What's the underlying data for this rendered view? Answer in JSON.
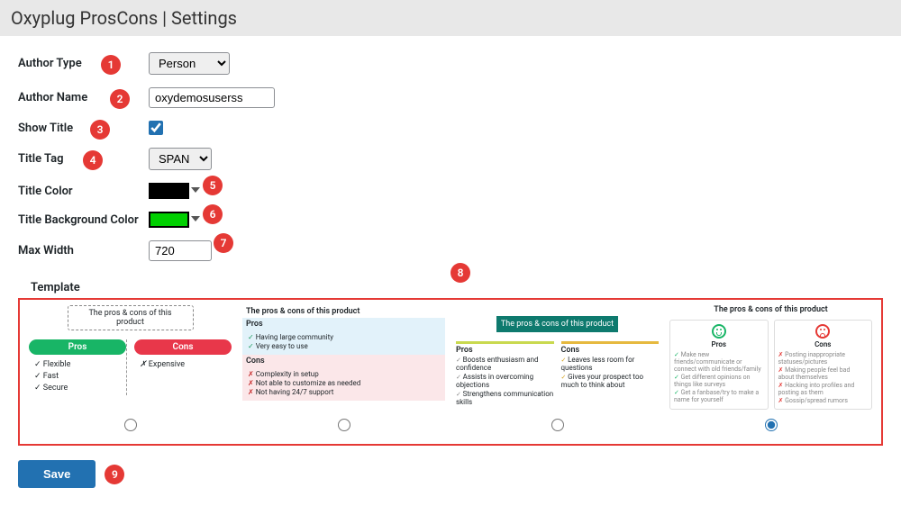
{
  "header": {
    "title": "Oxyplug ProsCons | Settings"
  },
  "form": {
    "author_type": {
      "label": "Author Type",
      "value": "Person",
      "badge": "1"
    },
    "author_name": {
      "label": "Author Name",
      "value": "oxydemosuserss",
      "badge": "2"
    },
    "show_title": {
      "label": "Show Title",
      "checked": true,
      "badge": "3"
    },
    "title_tag": {
      "label": "Title Tag",
      "value": "SPAN",
      "badge": "4"
    },
    "title_color": {
      "label": "Title Color",
      "value": "#000000",
      "badge": "5"
    },
    "title_bg": {
      "label": "Title Background Color",
      "value": "#00d000",
      "badge": "6"
    },
    "max_width": {
      "label": "Max Width",
      "value": "720",
      "badge": "7"
    }
  },
  "templates": {
    "label": "Template",
    "badge": "8",
    "selected": 3,
    "items": [
      {
        "title": "The pros & cons of this product",
        "pros_label": "Pros",
        "cons_label": "Cons",
        "pros": [
          "Flexible",
          "Fast",
          "Secure"
        ],
        "cons": [
          "Expensive"
        ]
      },
      {
        "title": "The pros & cons of this product",
        "pros_label": "Pros",
        "cons_label": "Cons",
        "pros": [
          "Having large community",
          "Very easy to use"
        ],
        "cons": [
          "Complexity in setup",
          "Not able to customize as needed",
          "Not having 24/7 support"
        ]
      },
      {
        "title": "The pros & cons of this product",
        "pros_label": "Pros",
        "cons_label": "Cons",
        "pros": [
          "Boosts enthusiasm and confidence",
          "Assists in overcoming objections",
          "Strengthens communication skills"
        ],
        "cons": [
          "Leaves less room for questions",
          "Gives your prospect too much to think about"
        ]
      },
      {
        "title": "The pros & cons of this product",
        "pros_label": "Pros",
        "cons_label": "Cons",
        "pros": [
          "Make new friends/communicate or connect with old friends/family",
          "Get different opinions on things like surveys",
          "Get a fanbase/try to make a name for yourself"
        ],
        "cons": [
          "Posting inappropriate statuses/pictures",
          "Making people feel bad about themselves",
          "Hacking into profiles and posting as them",
          "Gossip/spread rumors"
        ]
      }
    ]
  },
  "save": {
    "label": "Save",
    "badge": "9"
  }
}
